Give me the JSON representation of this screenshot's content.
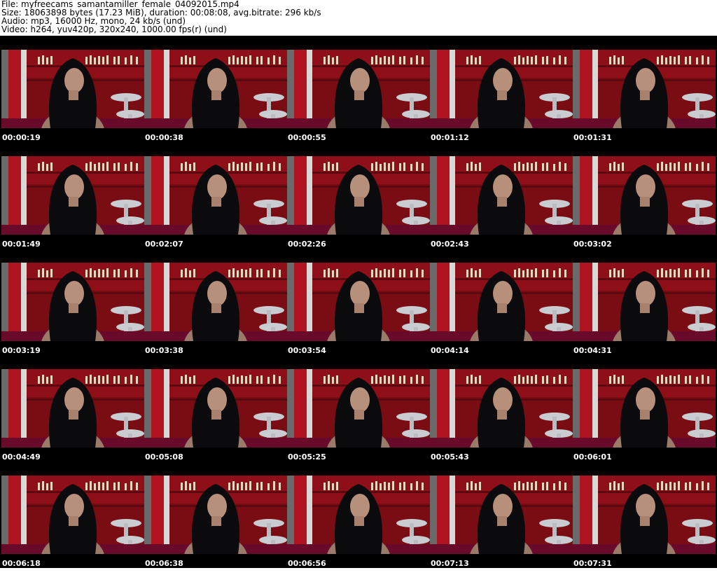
{
  "header": {
    "file_line": "File: myfreecams_samantamiller_female_04092015.mp4",
    "size_line": "Size: 18063898 bytes (17.23 MiB), duration: 00:08:08, avg.bitrate: 296 kb/s",
    "audio_line": "Audio: mp3, 16000 Hz, mono, 24 kb/s (und)",
    "video_line": "Video: h264, yuv420p, 320x240, 1000.00 fps(r) (und)"
  },
  "thumbnails": [
    {
      "timestamp": "00:00:19"
    },
    {
      "timestamp": "00:00:38"
    },
    {
      "timestamp": "00:00:55"
    },
    {
      "timestamp": "00:01:12"
    },
    {
      "timestamp": "00:01:31"
    },
    {
      "timestamp": "00:01:49"
    },
    {
      "timestamp": "00:02:07"
    },
    {
      "timestamp": "00:02:26"
    },
    {
      "timestamp": "00:02:43"
    },
    {
      "timestamp": "00:03:02"
    },
    {
      "timestamp": "00:03:19"
    },
    {
      "timestamp": "00:03:38"
    },
    {
      "timestamp": "00:03:54"
    },
    {
      "timestamp": "00:04:14"
    },
    {
      "timestamp": "00:04:31"
    },
    {
      "timestamp": "00:04:49"
    },
    {
      "timestamp": "00:05:08"
    },
    {
      "timestamp": "00:05:25"
    },
    {
      "timestamp": "00:05:43"
    },
    {
      "timestamp": "00:06:01"
    },
    {
      "timestamp": "00:06:18"
    },
    {
      "timestamp": "00:06:38"
    },
    {
      "timestamp": "00:06:56"
    },
    {
      "timestamp": "00:07:13"
    },
    {
      "timestamp": "00:07:31"
    }
  ],
  "colors": {
    "sheet_background": "#000000",
    "header_background": "#ffffff",
    "header_text": "#000000",
    "timestamp_text": "#ffffff",
    "wall_red": "#a8101c",
    "bar_stools": "#c9ccd0"
  }
}
